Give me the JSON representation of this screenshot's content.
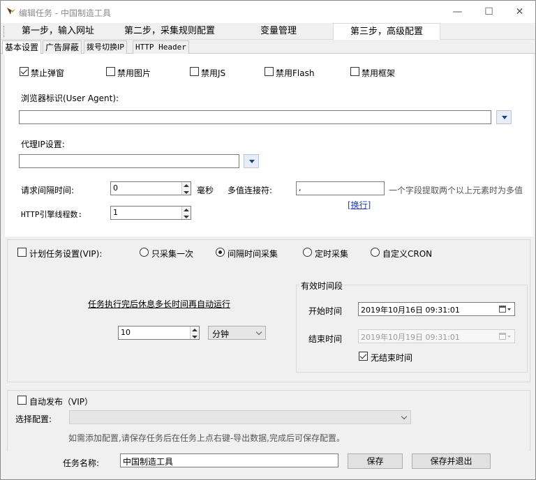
{
  "window": {
    "title": "编辑任务 - 中国制造工具",
    "minimize": "—",
    "maximize": "☐",
    "close": "✕"
  },
  "steps": [
    "第一步，输入网址",
    "第二步，采集规则配置",
    "变量管理",
    "第三步，高级配置"
  ],
  "subtabs": [
    "基本设置",
    "广告屏蔽",
    "拨号切换IP",
    "HTTP Header"
  ],
  "options": {
    "block_popup": {
      "label": "禁止弹窗",
      "checked": true
    },
    "disable_images": {
      "label": "禁用图片",
      "checked": false
    },
    "disable_js": {
      "label": "禁用JS",
      "checked": false
    },
    "disable_flash": {
      "label": "禁用Flash",
      "checked": false
    },
    "disable_frames": {
      "label": "禁用框架",
      "checked": false
    }
  },
  "user_agent": {
    "label": "浏览器标识(User Agent):",
    "value": ""
  },
  "proxy": {
    "label": "代理IP设置:",
    "value": ""
  },
  "request_interval": {
    "label": "请求间隔时间:",
    "value": "0",
    "unit": "毫秒"
  },
  "multi_join": {
    "label": "多值连接符:",
    "value": ",",
    "hint": "一个字段提取两个以上元素时为多值",
    "newline_link": "[换行]"
  },
  "http_threads": {
    "label": "HTTP引擎线程数:",
    "value": "1"
  },
  "schedule": {
    "label": "计划任务设置(VIP):",
    "checked": false,
    "modes": [
      {
        "label": "只采集一次",
        "checked": false
      },
      {
        "label": "间隔时间采集",
        "checked": true
      },
      {
        "label": "定时采集",
        "checked": false
      },
      {
        "label": "自定义CRON",
        "checked": false
      }
    ],
    "rest_link": "任务执行完后休息多长时间再自动运行",
    "interval_value": "10",
    "interval_unit": "分钟",
    "valid_period": {
      "title": "有效时间段",
      "start_label": "开始时间",
      "start_value": "2019年10月16日  09:31:01",
      "end_label": "结束时间",
      "end_value": "2019年10月19日  09:31:01",
      "no_end": {
        "label": "无结束时间",
        "checked": true
      }
    }
  },
  "auto_publish": {
    "label": "自动发布（VIP）",
    "checked": false,
    "config_label": "选择配置:",
    "config_value": "",
    "hint": "如需添加配置,请保存任务后在任务上点右键-导出数据,完成后可保存配置。"
  },
  "footer": {
    "task_name_label": "任务名称:",
    "task_name_value": "中国制造工具",
    "save": "保存",
    "save_exit": "保存并退出"
  }
}
